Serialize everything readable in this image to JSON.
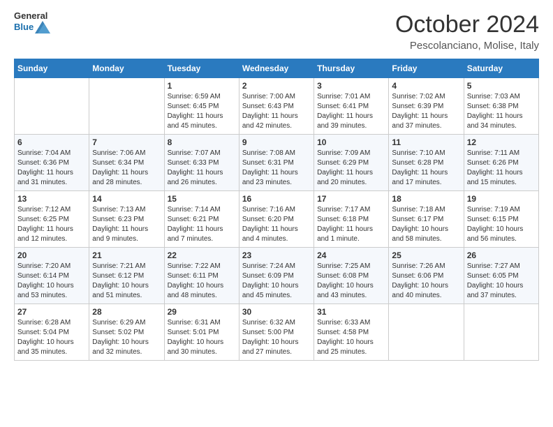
{
  "header": {
    "logo_general": "General",
    "logo_blue": "Blue",
    "month_title": "October 2024",
    "location": "Pescolanciano, Molise, Italy"
  },
  "days_of_week": [
    "Sunday",
    "Monday",
    "Tuesday",
    "Wednesday",
    "Thursday",
    "Friday",
    "Saturday"
  ],
  "weeks": [
    [
      {
        "day": "",
        "info": ""
      },
      {
        "day": "",
        "info": ""
      },
      {
        "day": "1",
        "info": "Sunrise: 6:59 AM\nSunset: 6:45 PM\nDaylight: 11 hours and 45 minutes."
      },
      {
        "day": "2",
        "info": "Sunrise: 7:00 AM\nSunset: 6:43 PM\nDaylight: 11 hours and 42 minutes."
      },
      {
        "day": "3",
        "info": "Sunrise: 7:01 AM\nSunset: 6:41 PM\nDaylight: 11 hours and 39 minutes."
      },
      {
        "day": "4",
        "info": "Sunrise: 7:02 AM\nSunset: 6:39 PM\nDaylight: 11 hours and 37 minutes."
      },
      {
        "day": "5",
        "info": "Sunrise: 7:03 AM\nSunset: 6:38 PM\nDaylight: 11 hours and 34 minutes."
      }
    ],
    [
      {
        "day": "6",
        "info": "Sunrise: 7:04 AM\nSunset: 6:36 PM\nDaylight: 11 hours and 31 minutes."
      },
      {
        "day": "7",
        "info": "Sunrise: 7:06 AM\nSunset: 6:34 PM\nDaylight: 11 hours and 28 minutes."
      },
      {
        "day": "8",
        "info": "Sunrise: 7:07 AM\nSunset: 6:33 PM\nDaylight: 11 hours and 26 minutes."
      },
      {
        "day": "9",
        "info": "Sunrise: 7:08 AM\nSunset: 6:31 PM\nDaylight: 11 hours and 23 minutes."
      },
      {
        "day": "10",
        "info": "Sunrise: 7:09 AM\nSunset: 6:29 PM\nDaylight: 11 hours and 20 minutes."
      },
      {
        "day": "11",
        "info": "Sunrise: 7:10 AM\nSunset: 6:28 PM\nDaylight: 11 hours and 17 minutes."
      },
      {
        "day": "12",
        "info": "Sunrise: 7:11 AM\nSunset: 6:26 PM\nDaylight: 11 hours and 15 minutes."
      }
    ],
    [
      {
        "day": "13",
        "info": "Sunrise: 7:12 AM\nSunset: 6:25 PM\nDaylight: 11 hours and 12 minutes."
      },
      {
        "day": "14",
        "info": "Sunrise: 7:13 AM\nSunset: 6:23 PM\nDaylight: 11 hours and 9 minutes."
      },
      {
        "day": "15",
        "info": "Sunrise: 7:14 AM\nSunset: 6:21 PM\nDaylight: 11 hours and 7 minutes."
      },
      {
        "day": "16",
        "info": "Sunrise: 7:16 AM\nSunset: 6:20 PM\nDaylight: 11 hours and 4 minutes."
      },
      {
        "day": "17",
        "info": "Sunrise: 7:17 AM\nSunset: 6:18 PM\nDaylight: 11 hours and 1 minute."
      },
      {
        "day": "18",
        "info": "Sunrise: 7:18 AM\nSunset: 6:17 PM\nDaylight: 10 hours and 58 minutes."
      },
      {
        "day": "19",
        "info": "Sunrise: 7:19 AM\nSunset: 6:15 PM\nDaylight: 10 hours and 56 minutes."
      }
    ],
    [
      {
        "day": "20",
        "info": "Sunrise: 7:20 AM\nSunset: 6:14 PM\nDaylight: 10 hours and 53 minutes."
      },
      {
        "day": "21",
        "info": "Sunrise: 7:21 AM\nSunset: 6:12 PM\nDaylight: 10 hours and 51 minutes."
      },
      {
        "day": "22",
        "info": "Sunrise: 7:22 AM\nSunset: 6:11 PM\nDaylight: 10 hours and 48 minutes."
      },
      {
        "day": "23",
        "info": "Sunrise: 7:24 AM\nSunset: 6:09 PM\nDaylight: 10 hours and 45 minutes."
      },
      {
        "day": "24",
        "info": "Sunrise: 7:25 AM\nSunset: 6:08 PM\nDaylight: 10 hours and 43 minutes."
      },
      {
        "day": "25",
        "info": "Sunrise: 7:26 AM\nSunset: 6:06 PM\nDaylight: 10 hours and 40 minutes."
      },
      {
        "day": "26",
        "info": "Sunrise: 7:27 AM\nSunset: 6:05 PM\nDaylight: 10 hours and 37 minutes."
      }
    ],
    [
      {
        "day": "27",
        "info": "Sunrise: 6:28 AM\nSunset: 5:04 PM\nDaylight: 10 hours and 35 minutes."
      },
      {
        "day": "28",
        "info": "Sunrise: 6:29 AM\nSunset: 5:02 PM\nDaylight: 10 hours and 32 minutes."
      },
      {
        "day": "29",
        "info": "Sunrise: 6:31 AM\nSunset: 5:01 PM\nDaylight: 10 hours and 30 minutes."
      },
      {
        "day": "30",
        "info": "Sunrise: 6:32 AM\nSunset: 5:00 PM\nDaylight: 10 hours and 27 minutes."
      },
      {
        "day": "31",
        "info": "Sunrise: 6:33 AM\nSunset: 4:58 PM\nDaylight: 10 hours and 25 minutes."
      },
      {
        "day": "",
        "info": ""
      },
      {
        "day": "",
        "info": ""
      }
    ]
  ]
}
